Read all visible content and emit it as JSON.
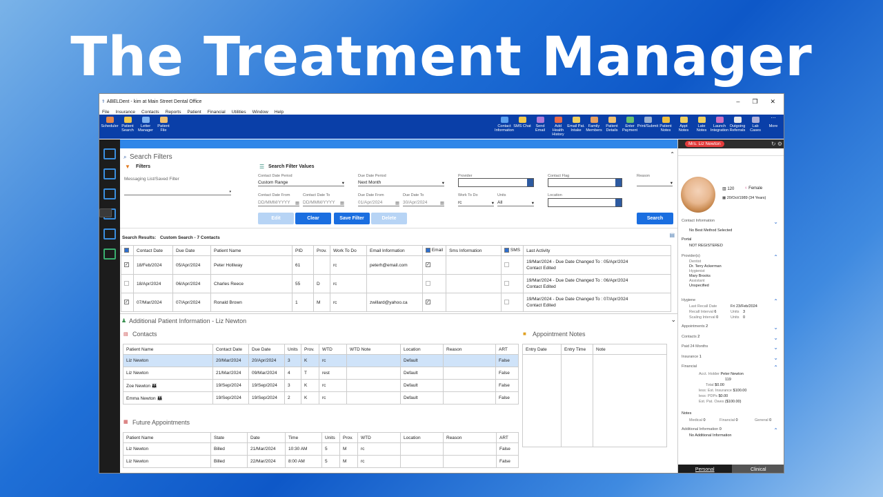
{
  "slide_title": "The Treatment Manager",
  "window": {
    "title": "ABELDent - kim at Main Street Dental Office"
  },
  "menu": [
    "File",
    "Insurance",
    "Contacts",
    "Reports",
    "Patient",
    "Financial",
    "Utilities",
    "Window",
    "Help"
  ],
  "ribbon_left": [
    "Scheduler",
    "Patient Search",
    "Letter Manager",
    "Patient File"
  ],
  "ribbon_right": [
    "Contact Information",
    "SMS Chat",
    "Send Email",
    "Add Health History",
    "Email Pat. Intake",
    "Family Members",
    "Patient Details",
    "Enter Payment",
    "Print/Submit",
    "Patient Notes",
    "Appt Notes",
    "Late Notes",
    "Launch Integration",
    "Outgoing Referrals",
    "Lab Cases",
    "More"
  ],
  "filters": {
    "title": "Search Filters",
    "filters_label": "Filters",
    "saved_label": "Messaging List/Saved Filter",
    "values_label": "Search Filter Values",
    "contact_period_label": "Contact Date Period",
    "contact_period": "Custom Range",
    "due_period_label": "Due Date Period",
    "due_period": "Next Month",
    "provider_label": "Provider",
    "contact_flag_label": "Contact Flag",
    "reason_label": "Reason",
    "contact_from_label": "Contact Date From",
    "contact_from": "DD/MMM/YYYY",
    "contact_to_label": "Contact Date To",
    "contact_to": "DD/MMM/YYYY",
    "due_from_label": "Due Date From",
    "due_from": "01/Apr/2024",
    "due_to_label": "Due Date To",
    "due_to": "30/Apr/2024",
    "work_label": "Work To Do",
    "work": "rc",
    "units_label": "Units",
    "units": "All",
    "location_label": "Location",
    "btn_edit": "Edit",
    "btn_clear": "Clear",
    "btn_save": "Save Filter",
    "btn_delete": "Delete",
    "btn_search": "Search"
  },
  "results": {
    "label": "Search Results:",
    "summary": "Custom Search - 7 Contacts",
    "headers": [
      "Contact Date",
      "Due Date",
      "Patient Name",
      "PID",
      "Prov.",
      "Work To Do",
      "Email Information",
      "Email",
      "Sms Information",
      "SMS",
      "Last Activity"
    ],
    "rows": [
      {
        "checked": true,
        "contact": "18/Feb/2024",
        "due": "05/Apr/2024",
        "name": "Peter Holliway",
        "pid": "61",
        "prov": "",
        "work": "rc",
        "email": "peterh@email.com",
        "email_chk": true,
        "act1": "19/Mar/2024 - Due Date Changed To : 05/Apr/2024",
        "act2": "Contact Edited"
      },
      {
        "checked": false,
        "contact": "18/Apr/2024",
        "due": "06/Apr/2024",
        "name": "Charles Reece",
        "pid": "55",
        "prov": "D",
        "work": "rc",
        "email": "",
        "email_chk": false,
        "act1": "19/Mar/2024 - Due Date Changed To : 06/Apr/2024",
        "act2": "Contact Edited"
      },
      {
        "checked": true,
        "contact": "07/Mar/2024",
        "due": "07/Apr/2024",
        "name": "Ronald Brown",
        "pid": "1",
        "prov": "M",
        "work": "rc",
        "email": "zwillard@yahoo.ca",
        "email_chk": true,
        "act1": "19/Mar/2024 - Due Date Changed To : 07/Apr/2024",
        "act2": "Contact Edited"
      }
    ]
  },
  "additional": {
    "title": "Additional Patient Information - Liz Newton",
    "contacts_title": "Contacts",
    "contacts_headers": [
      "Patient Name",
      "Contact Date",
      "Due Date",
      "Units",
      "Prov.",
      "WTD",
      "WTD Note",
      "Location",
      "Reason",
      "ART"
    ],
    "contacts": [
      [
        "Liz Newton",
        "20/Mar/2024",
        "20/Apr/2024",
        "3",
        "K",
        "rc",
        "",
        "Default",
        "",
        "False"
      ],
      [
        "Liz Newton",
        "21/Mar/2024",
        "09/Mar/2024",
        "4",
        "T",
        "rest",
        "",
        "Default",
        "",
        "False"
      ],
      [
        "Zoe Newton",
        "19/Sep/2024",
        "19/Sep/2024",
        "3",
        "K",
        "rc",
        "",
        "Default",
        "",
        "False"
      ],
      [
        "Emma Newton",
        "19/Sep/2024",
        "19/Sep/2024",
        "2",
        "K",
        "rc",
        "",
        "Default",
        "",
        "False"
      ]
    ],
    "appt_notes_title": "Appointment Notes",
    "appt_notes_headers": [
      "Entry Date",
      "Entry Time",
      "Note"
    ],
    "future_title": "Future Appointments",
    "future_headers": [
      "Patient Name",
      "State",
      "Date",
      "Time",
      "Units",
      "Prov.",
      "WTD",
      "Location",
      "Reason",
      "ART"
    ],
    "future": [
      [
        "Liz Newton",
        "Billed",
        "21/Mar/2024",
        "10:30 AM",
        "5",
        "M",
        "rc",
        "",
        "",
        "False"
      ],
      [
        "Liz Newton",
        "Billed",
        "22/Mar/2024",
        "8:00 AM",
        "5",
        "M",
        "rc",
        "",
        "",
        "False"
      ]
    ]
  },
  "patient": {
    "name": "Mrs. Liz Newton",
    "pid": "120",
    "gender": "Female",
    "dob": "20/Oct/1989 (34 Years)",
    "contact_info": "Contact Information",
    "contact_method": "No Best Method Selected",
    "portal": "Portal",
    "portal_status": "NOT REGISTERED",
    "providers": "Provider(s)",
    "dentist_lbl": "Dentist",
    "dentist": "Dr. Terry Ackerman",
    "hygienist_lbl": "Hygienist",
    "hygienist": "Mary Brooks",
    "assistant_lbl": "Assistant",
    "assistant": "Unspecified",
    "hygiene": "Hygiene",
    "last_recall_lbl": "Last Recall Date",
    "last_recall": "Fri 23/Feb/2024",
    "recall_int": "Recall Interval",
    "recall_val": "6",
    "units_lbl": "Units",
    "units_val": "3",
    "scaling_int": "Scaling Interval",
    "scaling_val": "0",
    "units2_val": "0",
    "appointments": "Appointments",
    "appointments_n": "2",
    "contacts": "Contacts",
    "contacts_n": "2",
    "paid": "Paid 24 Months",
    "insurance": "Insurance",
    "insurance_n": "1",
    "financial": "Financial",
    "acct_holder_lbl": "Acct. Holder",
    "acct_holder": "Peter Newton",
    "acct_id": "119",
    "total_lbl": "Total",
    "total": "$0.00",
    "est_ins_lbl": "less: Est. Insurance",
    "est_ins": "$100.00",
    "pdps_lbl": "less: PDPs",
    "pdps": "$0.00",
    "owes_lbl": "Est. Pat. Owes",
    "owes": "($100.00)",
    "notes": "Notes",
    "medical": "Medical",
    "medical_n": "0",
    "financial_n_lbl": "Financial",
    "financial_n": "0",
    "general": "General",
    "general_n": "0",
    "addl": "Additional Information",
    "addl_n": "0",
    "addl_val": "No Additional Information",
    "tab_personal": "Personal",
    "tab_clinical": "Clinical"
  }
}
